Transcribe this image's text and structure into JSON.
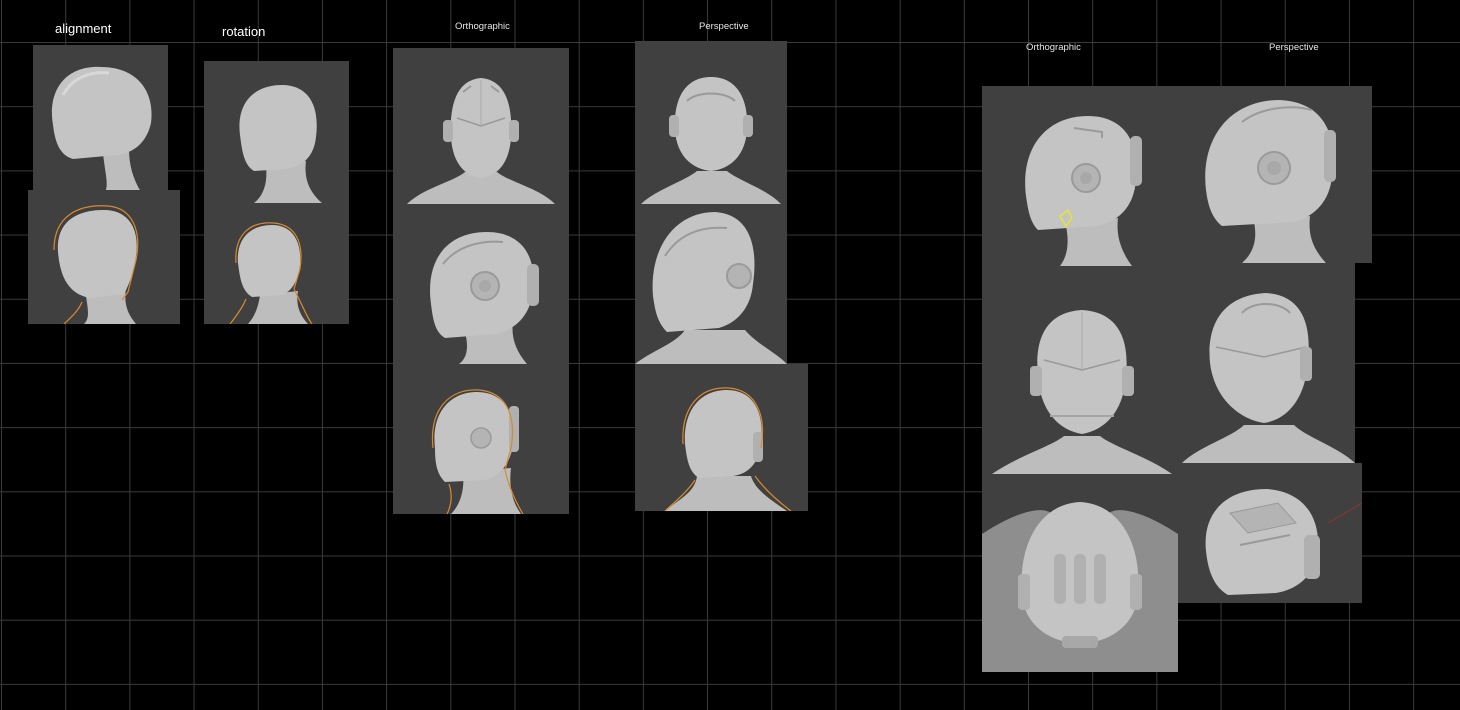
{
  "labels": {
    "alignment": "alignment",
    "rotation": "rotation",
    "ortho_1": "Orthographic",
    "persp_1": "Perspective",
    "ortho_2": "Orthographic",
    "persp_2": "Perspective"
  },
  "colors": {
    "background": "#000000",
    "grid": "#3a3a3a",
    "panel": "#404040",
    "clay": "#c2c2c2",
    "outline": "#d98a2b",
    "selection": "#e6e632"
  }
}
